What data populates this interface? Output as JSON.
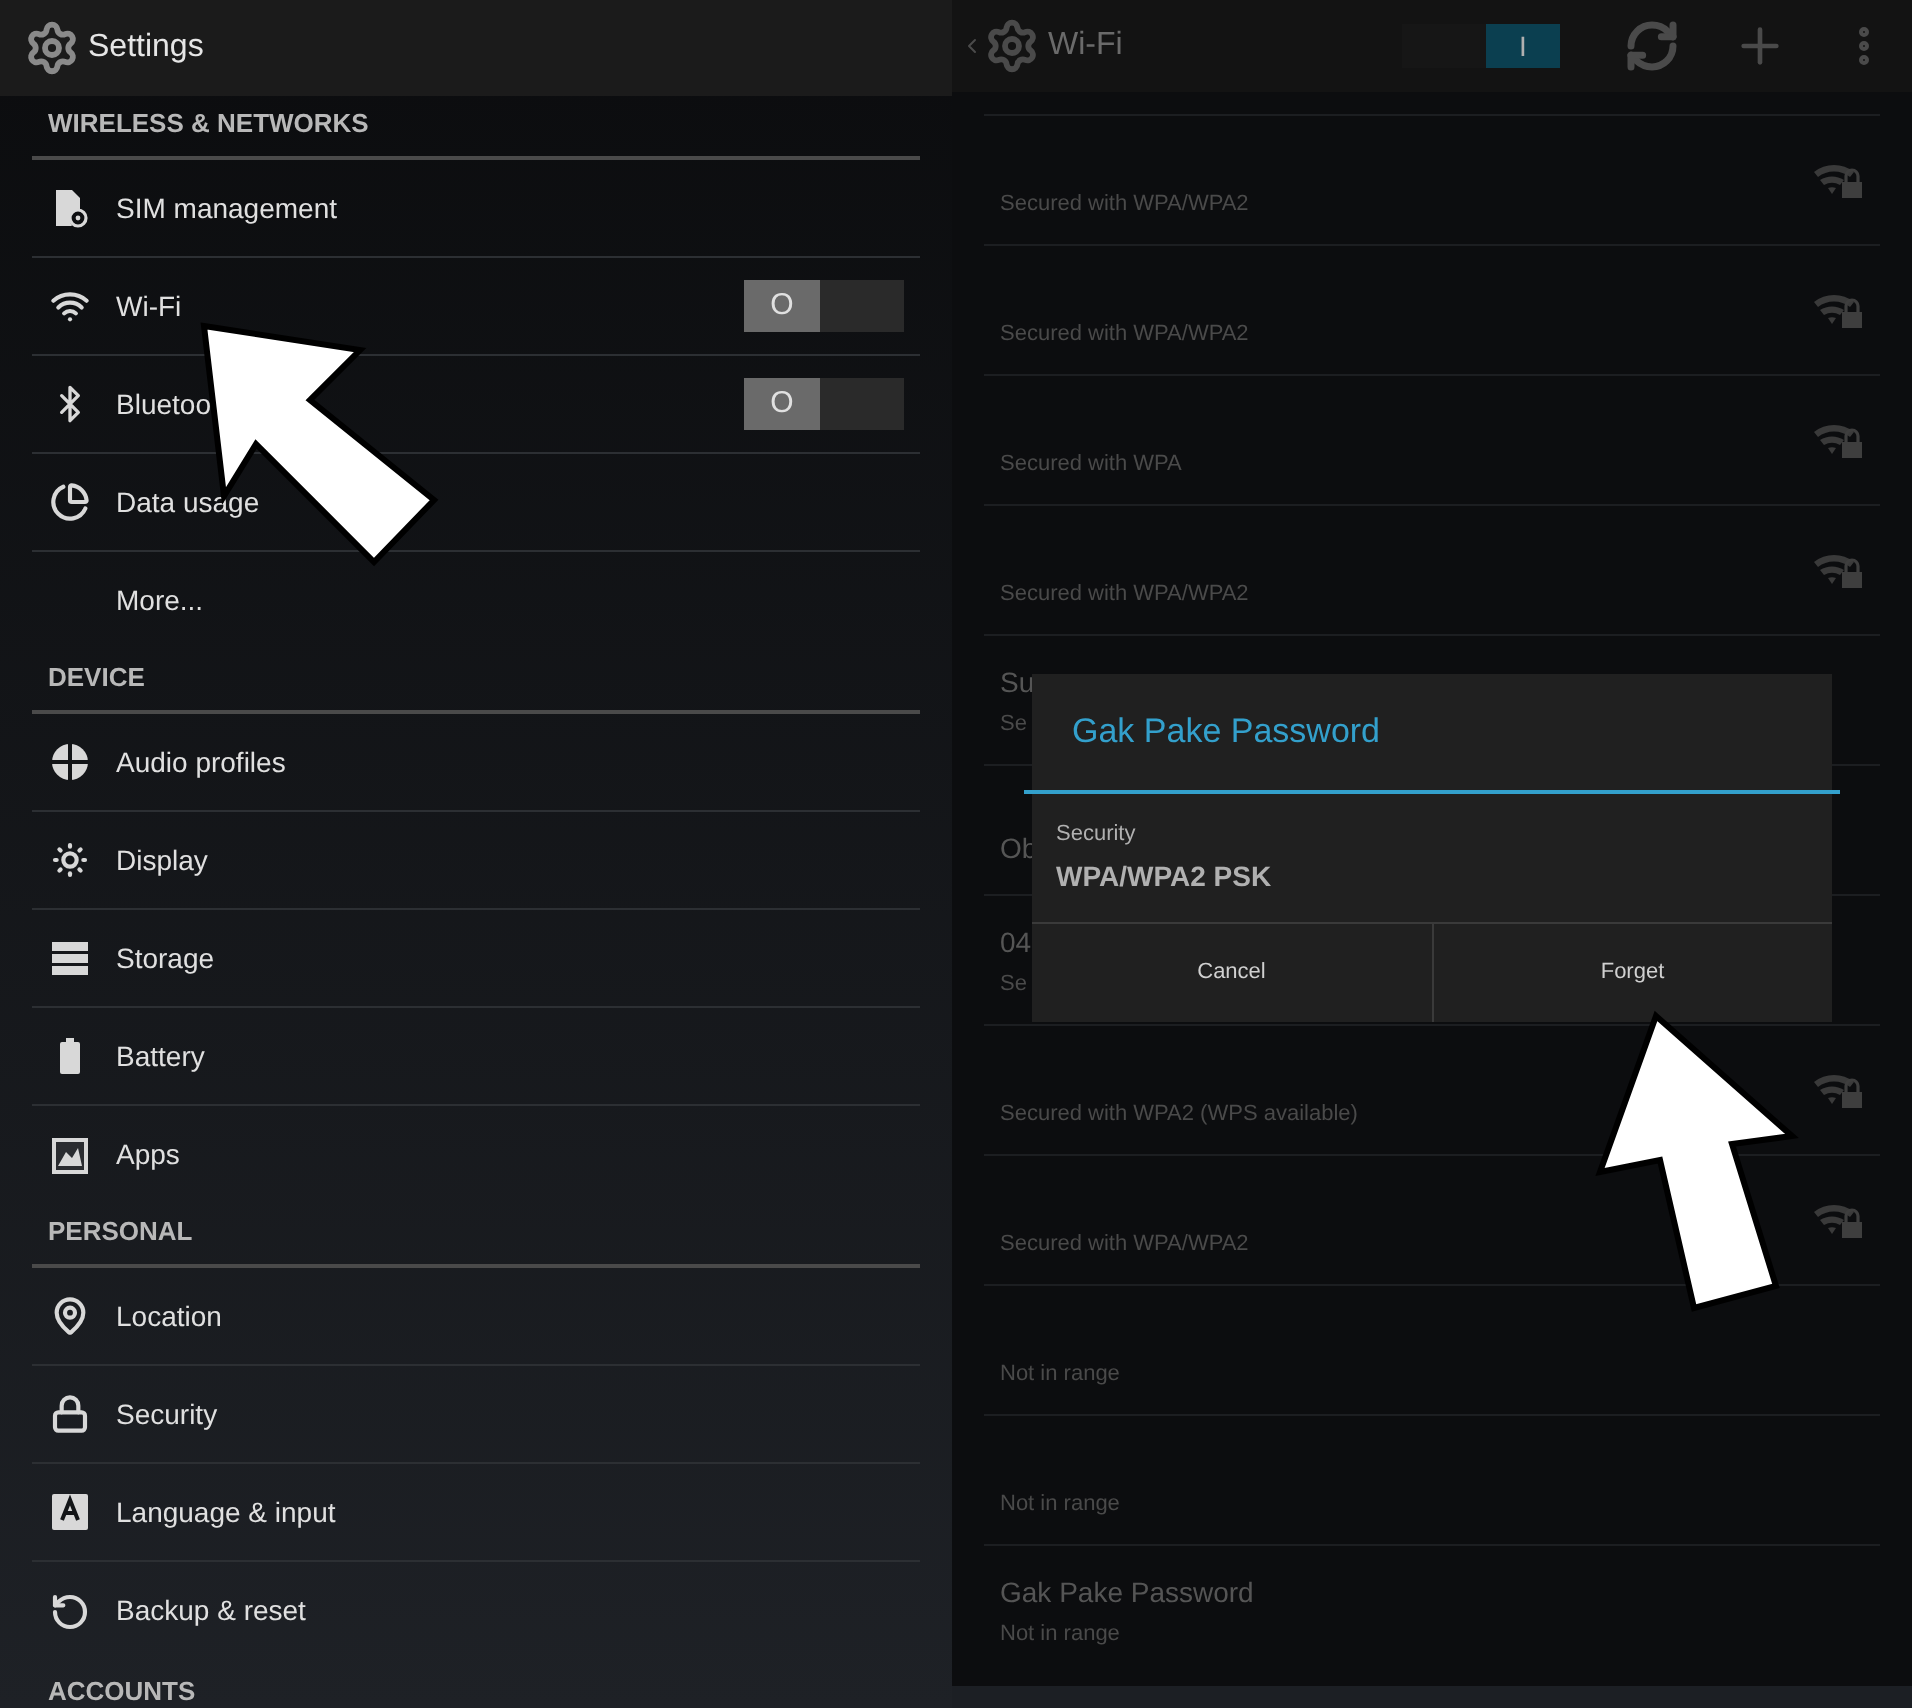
{
  "settings": {
    "title": "Settings",
    "sections": [
      {
        "header": "WIRELESS & NETWORKS",
        "items": [
          {
            "label": "SIM management",
            "kind": "sim"
          },
          {
            "label": "Wi-Fi",
            "kind": "wifi",
            "toggle": {
              "on": false,
              "label": "O"
            }
          },
          {
            "label": "Bluetoo",
            "kind": "bluetooth",
            "toggle": {
              "on": false,
              "label": "O"
            }
          },
          {
            "label": "Data usage",
            "kind": "data"
          },
          {
            "label": "More...",
            "kind": "plain"
          }
        ]
      },
      {
        "header": "DEVICE",
        "items": [
          {
            "label": "Audio profiles",
            "kind": "audio"
          },
          {
            "label": "Display",
            "kind": "display"
          },
          {
            "label": "Storage",
            "kind": "storage"
          },
          {
            "label": "Battery",
            "kind": "battery"
          },
          {
            "label": "Apps",
            "kind": "apps"
          }
        ]
      },
      {
        "header": "PERSONAL",
        "items": [
          {
            "label": "Location",
            "kind": "location"
          },
          {
            "label": "Security",
            "kind": "lock"
          },
          {
            "label": "Language & input",
            "kind": "language"
          },
          {
            "label": "Backup & reset",
            "kind": "backup"
          }
        ]
      },
      {
        "header": "ACCOUNTS"
      }
    ]
  },
  "wifi": {
    "title": "Wi-Fi",
    "master_switch": {
      "on": true,
      "label": "I"
    },
    "networks": [
      {
        "status": "Secured with WPA/WPA2",
        "signal_icon": true
      },
      {
        "status": "Secured with WPA/WPA2",
        "signal_icon": true
      },
      {
        "status": "Secured with WPA",
        "signal_icon": true
      },
      {
        "status": "Secured with WPA/WPA2",
        "signal_icon": true
      },
      {
        "name": "Su",
        "status": "Se",
        "signal_icon": false
      },
      {
        "name": "Ob",
        "signal_icon": false
      },
      {
        "name": "04",
        "status": "Se",
        "signal_icon": false
      },
      {
        "status": "Secured with WPA2 (WPS available)",
        "signal_icon": true
      },
      {
        "status": "Secured with WPA/WPA2",
        "signal_icon": true
      },
      {
        "status": "Not in range",
        "signal_icon": false
      },
      {
        "status": "Not in range",
        "signal_icon": false
      },
      {
        "name": "Gak Pake Password",
        "status": "Not in range",
        "signal_icon": false
      }
    ]
  },
  "dialog": {
    "title": "Gak Pake Password",
    "field_label": "Security",
    "field_value": "WPA/WPA2 PSK",
    "buttons": [
      "Cancel",
      "Forget"
    ]
  }
}
